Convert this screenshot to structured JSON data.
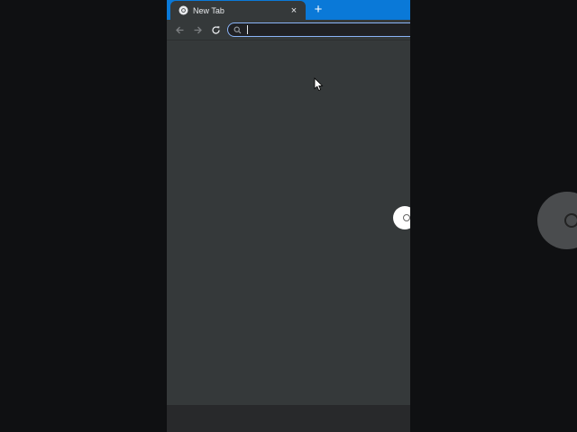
{
  "browser": {
    "tab": {
      "title": "New Tab",
      "favicon": "chrome-icon",
      "close": "×"
    },
    "new_tab": "+",
    "toolbar": {
      "back_icon": "arrow-left-icon",
      "forward_icon": "arrow-right-icon",
      "reload_icon": "reload-icon"
    },
    "omnibox": {
      "icon": "search-icon",
      "value": "",
      "placeholder": ""
    }
  },
  "colors": {
    "tabstrip": "#0a79d8",
    "page_background": "#35393a",
    "outer_background": "#0f1012",
    "omnibox_border": "#8ab4f8"
  }
}
